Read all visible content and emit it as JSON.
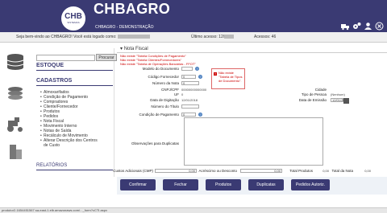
{
  "header": {
    "logo_text": "CHB",
    "logo_sub": "SISTEMAS",
    "brand": "CHBAGRO",
    "subtitle": "CHBAGRO - DEMONSTRAÇÃO",
    "icons": [
      "truck-icon",
      "gears-icon",
      "user-icon",
      "close-icon"
    ]
  },
  "welcome": {
    "greeting": "Seja bem-vindo ao CHBAGRO! Você está logado como:",
    "last_access_label": "Último acesso: 12/",
    "access_count": "Acessos: 46"
  },
  "sidebar": {
    "search_button": "Procurar",
    "estoque": "ESTOQUE",
    "cadastros": "CADASTROS",
    "items": [
      "Almoxarifados",
      "Condição de Pagamento",
      "Compradores",
      "Cliente/Fornecedor",
      "Produtos",
      "Pedidos",
      "Nota Fiscal",
      "Movimento Interno",
      "Notas de Saída",
      "Recálculo de Movimento",
      "Alterar Descrição dos Centros",
      "de Custo"
    ],
    "relatorios": "RELATÓRIOS"
  },
  "form": {
    "title": "Nota Fiscal",
    "messages": [
      "Não existe \"Tabela Condições de Pagamento\"",
      "Não existe \"Tabela Clientes/Fornecedores\"",
      "Não existe \"Tabela de Operações Bancárias - FFOT\""
    ],
    "labels": {
      "modelo": "Modelo do Documento",
      "fornecedor": "Código Fornecedor",
      "numero": "Número da Nota",
      "cnpj": "CNPJ/CPF",
      "uf": "UF",
      "data_digitacao": "Data de Digitação",
      "numero_titulo": "Número do Título",
      "condicao": "Condição de Pagamento",
      "cidade": "Cidade",
      "tipo_pessoa": "Tipo de Pessoa",
      "data_emissao": "Data de Emissão",
      "observacoes": "Observações para Duplicatas",
      "custos": "Custos Adicionais (CMP)",
      "acrescimo": "Acréscimo ou Desconto",
      "total_produtos": "Total Produtos",
      "total_nota": "Total da Nota"
    },
    "values": {
      "modelo": "",
      "fornecedor": "0",
      "numero": "0",
      "cnpj": "00000000000000",
      "uf": "0",
      "data_digitacao": "12/01/2018",
      "numero_titulo": "",
      "condicao": "0",
      "tipo_pessoa": "(Nenhum)",
      "data_emissao": "12/01/2018",
      "custos": "0,00",
      "acrescimo": "0,00",
      "total_produtos": "0,00",
      "total_nota": "0,00"
    },
    "warning": "Não existe \"Tabela de Tipos de Documento\"."
  },
  "buttons": [
    "Confirmar",
    "Fechar",
    "Produtos",
    "Duplicatas",
    "Pedidos Autoriz."
  ],
  "status": "produtor2-1654451567.sa-east-1.elb.amazonaws.com/..._form?cCTI.aspx"
}
